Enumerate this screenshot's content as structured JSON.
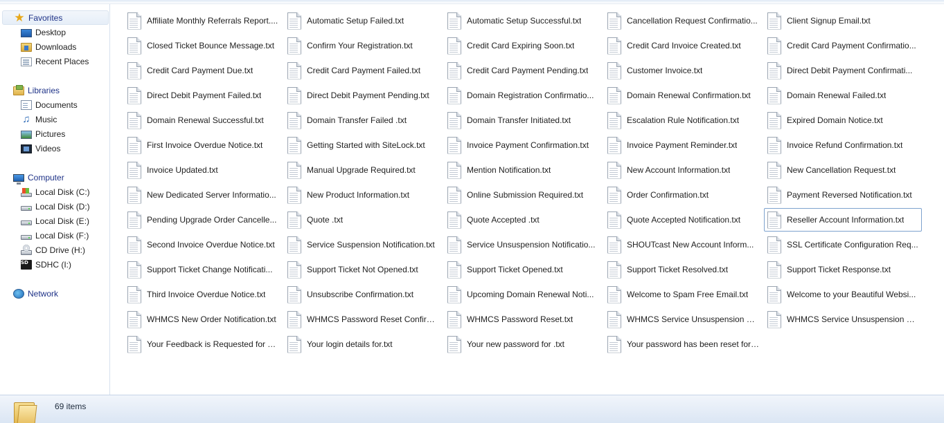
{
  "nav": {
    "favorites": {
      "label": "Favorites",
      "icon": "star-icon",
      "items": [
        {
          "label": "Desktop",
          "icon": "desktop-icon"
        },
        {
          "label": "Downloads",
          "icon": "downloads-folder-icon"
        },
        {
          "label": "Recent Places",
          "icon": "recent-places-icon"
        }
      ]
    },
    "libraries": {
      "label": "Libraries",
      "icon": "libraries-icon",
      "items": [
        {
          "label": "Documents",
          "icon": "documents-icon"
        },
        {
          "label": "Music",
          "icon": "music-icon"
        },
        {
          "label": "Pictures",
          "icon": "pictures-icon"
        },
        {
          "label": "Videos",
          "icon": "videos-icon"
        }
      ]
    },
    "computer": {
      "label": "Computer",
      "icon": "computer-icon",
      "items": [
        {
          "label": "Local Disk (C:)",
          "icon": "system-drive-icon"
        },
        {
          "label": "Local Disk (D:)",
          "icon": "hard-drive-icon"
        },
        {
          "label": "Local Disk (E:)",
          "icon": "hard-drive-icon"
        },
        {
          "label": "Local Disk (F:)",
          "icon": "hard-drive-icon"
        },
        {
          "label": "CD Drive (H:)",
          "icon": "cd-drive-icon"
        },
        {
          "label": "SDHC (I:)",
          "icon": "sd-card-icon"
        }
      ]
    },
    "network": {
      "label": "Network",
      "icon": "network-icon"
    }
  },
  "files": [
    "Affiliate Monthly Referrals Report....",
    "Automatic Setup Failed.txt",
    "Automatic Setup Successful.txt",
    "Cancellation Request Confirmatio...",
    "Client Signup Email.txt",
    "Closed Ticket Bounce Message.txt",
    "Confirm Your Registration.txt",
    "Credit Card Expiring Soon.txt",
    "Credit Card Invoice Created.txt",
    "Credit Card Payment Confirmatio...",
    "Credit Card Payment Due.txt",
    "Credit Card Payment Failed.txt",
    "Credit Card Payment Pending.txt",
    "Customer Invoice.txt",
    "Direct Debit Payment Confirmati...",
    "Direct Debit Payment Failed.txt",
    "Direct Debit Payment Pending.txt",
    "Domain Registration Confirmatio...",
    "Domain Renewal Confirmation.txt",
    "Domain Renewal Failed.txt",
    "Domain Renewal Successful.txt",
    "Domain Transfer Failed .txt",
    "Domain Transfer Initiated.txt",
    "Escalation Rule Notification.txt",
    "Expired Domain Notice.txt",
    "First Invoice Overdue Notice.txt",
    "Getting Started with SiteLock.txt",
    "Invoice Payment Confirmation.txt",
    "Invoice Payment Reminder.txt",
    "Invoice Refund Confirmation.txt",
    "Invoice Updated.txt",
    "Manual Upgrade Required.txt",
    "Mention Notification.txt",
    "New Account Information.txt",
    "New Cancellation Request.txt",
    "New Dedicated Server Informatio...",
    "New Product Information.txt",
    "Online Submission Required.txt",
    "Order Confirmation.txt",
    "Payment Reversed Notification.txt",
    "Pending Upgrade Order Cancelle...",
    "Quote .txt",
    "Quote Accepted .txt",
    "Quote Accepted Notification.txt",
    "Reseller Account Information.txt",
    "Second Invoice Overdue Notice.txt",
    "Service Suspension Notification.txt",
    "Service Unsuspension Notificatio...",
    "SHOUTcast New Account Inform...",
    "SSL Certificate Configuration Req...",
    "Support Ticket Change Notificati...",
    "Support Ticket Not Opened.txt",
    "Support Ticket Opened.txt",
    "Support Ticket Resolved.txt",
    "Support Ticket Response.txt",
    "Third Invoice Overdue Notice.txt",
    "Unsubscribe Confirmation.txt",
    "Upcoming Domain Renewal Noti...",
    "Welcome to Spam Free Email.txt",
    "Welcome to your Beautiful Websi...",
    "WHMCS New Order Notification.txt",
    "WHMCS Password Reset Confirm...",
    "WHMCS Password Reset.txt",
    "WHMCS Service Unsuspension Fa...",
    "WHMCS Service Unsuspension Su...",
    "Your Feedback is Requested for Ti...",
    "Your login details for.txt",
    "Your new password for .txt",
    "Your password has been reset for ..."
  ],
  "selected_file": "Reseller Account Information.txt",
  "file_icon": "text-document-icon",
  "status": {
    "item_count": "69 items",
    "icon": "folder-icon"
  }
}
